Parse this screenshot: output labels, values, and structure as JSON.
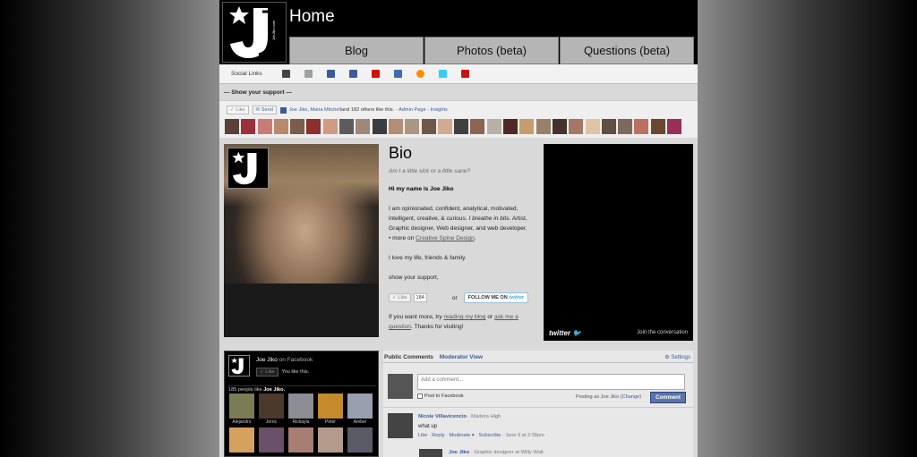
{
  "header": {
    "title": "Home",
    "logo_text": "JJ",
    "nav": [
      {
        "label": "Blog"
      },
      {
        "label": "Photos (beta)"
      },
      {
        "label": "Questions (beta)"
      }
    ]
  },
  "social": {
    "label": "Social Links",
    "icons": [
      {
        "name": "myspace-icon",
        "color": "#444444"
      },
      {
        "name": "deviantart-icon",
        "color": "#9aa39a"
      },
      {
        "name": "facebook-icon",
        "color": "#3b5998"
      },
      {
        "name": "facebook-page-icon",
        "color": "#3b5998"
      },
      {
        "name": "lastfm-icon",
        "color": "#d51007"
      },
      {
        "name": "formspring-icon",
        "color": "#3a6fb0"
      },
      {
        "name": "orange-icon",
        "color": "#ff8c00"
      },
      {
        "name": "twitter-icon",
        "color": "#33ccff"
      },
      {
        "name": "youtube-icon",
        "color": "#cc1111"
      }
    ]
  },
  "support": {
    "heading": "— Show your support —",
    "like_label": "Like",
    "send_label": "Send",
    "liked_by_1": "Joe Jiko",
    "liked_by_2": "Maria Mitchell",
    "liked_by_rest": " and 182 others like this.",
    "admin_page": "Admin Page",
    "insights": "Insights",
    "face_colors": [
      "#5a4038",
      "#9b2f3a",
      "#c97c77",
      "#b78a6d",
      "#7a5d4c",
      "#8e2e2e",
      "#d09b82",
      "#5c5c5c",
      "#a08878",
      "#3c3c3c",
      "#b38e74",
      "#ab9686",
      "#6e574b",
      "#d0aa91",
      "#404040",
      "#8d6352",
      "#b9b0a5",
      "#502a22",
      "#c79c6b",
      "#9a8069",
      "#46322c",
      "#a67766",
      "#dfc4a4",
      "#605040",
      "#7c6a5e",
      "#bc7060",
      "#6b4733",
      "#9b2e59"
    ]
  },
  "bio": {
    "title": "Bio",
    "question": "Am I a little sick or a little sane?",
    "greeting": "Hi my name is Joe Jiko",
    "para1": "I am opinionated, confident, analytical, motivated, intelligent, creative, & curious.",
    "para1_italic": "I breathe in bits.",
    "para1_rest": "Artist, Graphic designer, Web designer, and web developer.",
    "more_prefix": "• more on ",
    "more_link": "Creative Spine Design",
    "love": "I love my life, friends & family.",
    "support": "show your support,",
    "like_label": "Like",
    "like_count": "184",
    "or": "or",
    "follow_prefix": "FOLLOW ME ON ",
    "follow_brand": "twitter",
    "more_text_1": "If you want more, try ",
    "reading_link": "reading my blog",
    "more_text_2": " or ",
    "ask_link": "ask me a question",
    "more_text_3": ". Thanks for visiting!"
  },
  "twitter_box": {
    "logo": "twitter",
    "join": "Join the conversation"
  },
  "fb_box": {
    "name": "Joe Jiko",
    "on_fb": " on Facebook",
    "like_label": "Like",
    "you_like": "You like this.",
    "people_count": "185 people like ",
    "people_name": "Joe Jiko.",
    "people": [
      {
        "name": "Alejandro",
        "color": "#7b7b55"
      },
      {
        "name": "Jerric",
        "color": "#4b3a2c"
      },
      {
        "name": "Rickayla",
        "color": "#8d8d96"
      },
      {
        "name": "Peter",
        "color": "#c48a2c"
      },
      {
        "name": "Amber",
        "color": "#98a0b0"
      },
      {
        "name": "",
        "color": "#d6a15c"
      },
      {
        "name": "",
        "color": "#6a5068"
      },
      {
        "name": "",
        "color": "#a87d72"
      },
      {
        "name": "",
        "color": "#b49b8c"
      },
      {
        "name": "",
        "color": "#5b5b66"
      }
    ]
  },
  "comments": {
    "tab_public": "Public Comments",
    "tab_moderator": "Moderator View",
    "settings": "Settings",
    "placeholder": "Add a comment...",
    "post_to_fb": "Post to Facebook",
    "posting_as": "Posting as Joe Jiko (",
    "change": "Change",
    "posting_close": ")",
    "button": "Comment",
    "c1_name": "Nicole Villavicencio",
    "c1_meta": " · Madera High",
    "c1_text": "what up",
    "c1_like": "Like",
    "c1_reply": "Reply",
    "c1_moderate": "Moderate",
    "c1_subscribe": "Subscribe",
    "c1_date": " · June 9 at 2:38pm",
    "c2_name": "Joe Jiko",
    "c2_meta": " · Graphic designer at Willy Walt"
  }
}
